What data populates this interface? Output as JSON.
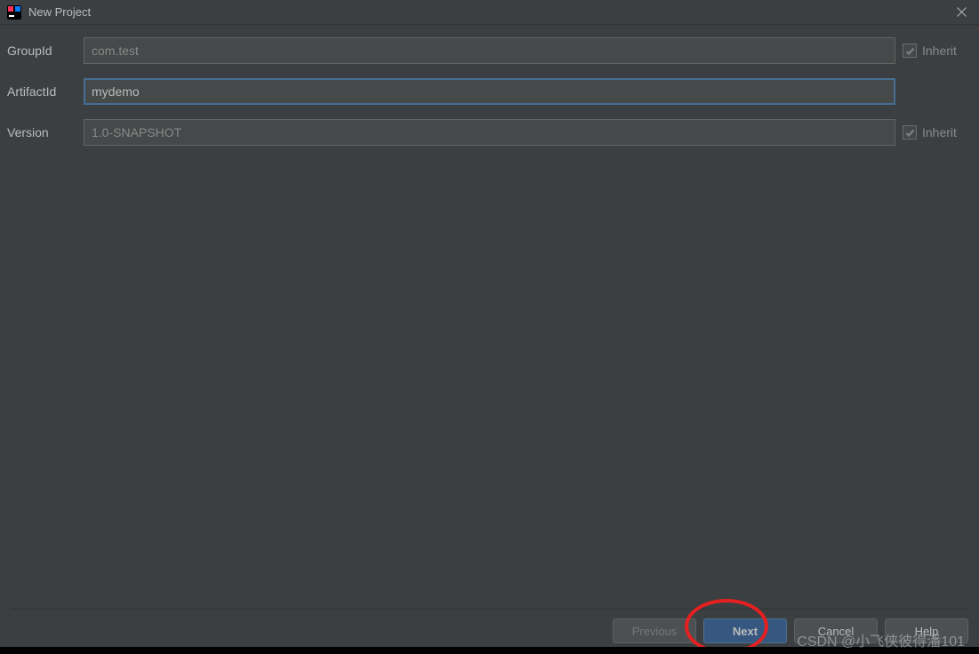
{
  "window": {
    "title": "New Project"
  },
  "form": {
    "groupId": {
      "label": "GroupId",
      "value": "com.test",
      "inherit_label": "Inherit",
      "inherit_checked": true
    },
    "artifactId": {
      "label": "ArtifactId",
      "value": "mydemo"
    },
    "version": {
      "label": "Version",
      "value": "1.0-SNAPSHOT",
      "inherit_label": "Inherit",
      "inherit_checked": true
    }
  },
  "buttons": {
    "previous": "Previous",
    "next": "Next",
    "cancel": "Cancel",
    "help": "Help"
  },
  "watermark": "CSDN @小飞侠彼得潘101"
}
